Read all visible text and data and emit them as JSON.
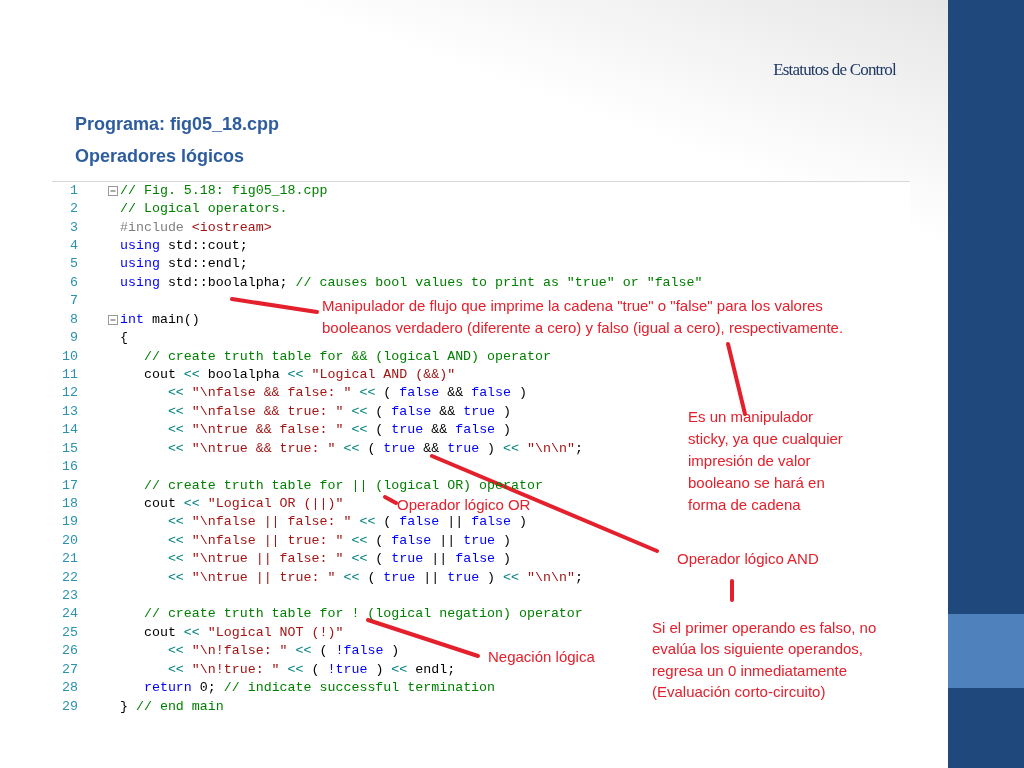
{
  "slide_title": "Estatutos de Control",
  "headings": [
    "Programa: fig05_18.cpp",
    "Operadores lógicos"
  ],
  "code": {
    "lines": [
      {
        "number": "1",
        "fold": true,
        "tokens": [
          {
            "kind": "comment",
            "text": "// Fig. 5.18: fig05_18.cpp"
          }
        ]
      },
      {
        "number": "2",
        "fold": false,
        "tokens": [
          {
            "kind": "comment",
            "text": "// Logical operators."
          }
        ]
      },
      {
        "number": "3",
        "fold": false,
        "tokens": [
          {
            "kind": "preprocessor",
            "text": "#include "
          },
          {
            "kind": "string",
            "text": "<iostream>"
          }
        ]
      },
      {
        "number": "4",
        "fold": false,
        "tokens": [
          {
            "kind": "keyword",
            "text": "using"
          },
          {
            "kind": "plain",
            "text": " std::cout;"
          }
        ]
      },
      {
        "number": "5",
        "fold": false,
        "tokens": [
          {
            "kind": "keyword",
            "text": "using"
          },
          {
            "kind": "plain",
            "text": " std::endl;"
          }
        ]
      },
      {
        "number": "6",
        "fold": false,
        "tokens": [
          {
            "kind": "keyword",
            "text": "using"
          },
          {
            "kind": "plain",
            "text": " std::boolalpha; "
          },
          {
            "kind": "comment",
            "text": "// causes bool values to print as \"true\" or \"false\""
          }
        ]
      },
      {
        "number": "7",
        "fold": false
      },
      {
        "number": "8",
        "fold": true,
        "tokens": [
          {
            "kind": "keyword",
            "text": "int"
          },
          {
            "kind": "plain",
            "text": " main()"
          }
        ]
      },
      {
        "number": "9",
        "fold": false,
        "tokens": [
          {
            "kind": "plain",
            "text": "{"
          }
        ]
      },
      {
        "number": "10",
        "fold": false,
        "tokens": [
          {
            "kind": "comment",
            "text": "   // create truth table for && (logical AND) operator"
          }
        ]
      },
      {
        "number": "11",
        "fold": false,
        "tokens": [
          {
            "kind": "plain",
            "text": "   cout "
          },
          {
            "kind": "operator",
            "text": "<<"
          },
          {
            "kind": "plain",
            "text": " boolalpha "
          },
          {
            "kind": "operator",
            "text": "<<"
          },
          {
            "kind": "string",
            "text": " \"Logical AND (&&)\""
          }
        ]
      },
      {
        "number": "12",
        "fold": false,
        "tokens": [
          {
            "kind": "operator",
            "text": "      <<"
          },
          {
            "kind": "string",
            "text": " \"\\nfalse && false: \" "
          },
          {
            "kind": "operator",
            "text": "<<"
          },
          {
            "kind": "plain",
            "text": " ( "
          },
          {
            "kind": "keyword",
            "text": "false"
          },
          {
            "kind": "plain",
            "text": " && "
          },
          {
            "kind": "keyword",
            "text": "false"
          },
          {
            "kind": "plain",
            "text": " )"
          }
        ]
      },
      {
        "number": "13",
        "fold": false,
        "tokens": [
          {
            "kind": "operator",
            "text": "      <<"
          },
          {
            "kind": "string",
            "text": " \"\\nfalse && true: \" "
          },
          {
            "kind": "operator",
            "text": "<<"
          },
          {
            "kind": "plain",
            "text": " ( "
          },
          {
            "kind": "keyword",
            "text": "false"
          },
          {
            "kind": "plain",
            "text": " && "
          },
          {
            "kind": "keyword",
            "text": "true"
          },
          {
            "kind": "plain",
            "text": " )"
          }
        ]
      },
      {
        "number": "14",
        "fold": false,
        "tokens": [
          {
            "kind": "operator",
            "text": "      <<"
          },
          {
            "kind": "string",
            "text": " \"\\ntrue && false: \" "
          },
          {
            "kind": "operator",
            "text": "<<"
          },
          {
            "kind": "plain",
            "text": " ( "
          },
          {
            "kind": "keyword",
            "text": "true"
          },
          {
            "kind": "plain",
            "text": " && "
          },
          {
            "kind": "keyword",
            "text": "false"
          },
          {
            "kind": "plain",
            "text": " )"
          }
        ]
      },
      {
        "number": "15",
        "fold": false,
        "tokens": [
          {
            "kind": "operator",
            "text": "      <<"
          },
          {
            "kind": "string",
            "text": " \"\\ntrue && true: \" "
          },
          {
            "kind": "operator",
            "text": "<<"
          },
          {
            "kind": "plain",
            "text": " ( "
          },
          {
            "kind": "keyword",
            "text": "true"
          },
          {
            "kind": "plain",
            "text": " && "
          },
          {
            "kind": "keyword",
            "text": "true"
          },
          {
            "kind": "plain",
            "text": " ) "
          },
          {
            "kind": "operator",
            "text": "<<"
          },
          {
            "kind": "string",
            "text": " \"\\n\\n\""
          },
          {
            "kind": "plain",
            "text": ";"
          }
        ]
      },
      {
        "number": "16",
        "fold": false
      },
      {
        "number": "17",
        "fold": false,
        "tokens": [
          {
            "kind": "comment",
            "text": "   // create truth table for || (logical OR) operator"
          }
        ]
      },
      {
        "number": "18",
        "fold": false,
        "tokens": [
          {
            "kind": "plain",
            "text": "   cout "
          },
          {
            "kind": "operator",
            "text": "<<"
          },
          {
            "kind": "string",
            "text": " \"Logical OR (||)\""
          }
        ]
      },
      {
        "number": "19",
        "fold": false,
        "tokens": [
          {
            "kind": "operator",
            "text": "      <<"
          },
          {
            "kind": "string",
            "text": " \"\\nfalse || false: \" "
          },
          {
            "kind": "operator",
            "text": "<<"
          },
          {
            "kind": "plain",
            "text": " ( "
          },
          {
            "kind": "keyword",
            "text": "false"
          },
          {
            "kind": "plain",
            "text": " || "
          },
          {
            "kind": "keyword",
            "text": "false"
          },
          {
            "kind": "plain",
            "text": " )"
          }
        ]
      },
      {
        "number": "20",
        "fold": false,
        "tokens": [
          {
            "kind": "operator",
            "text": "      <<"
          },
          {
            "kind": "string",
            "text": " \"\\nfalse || true: \" "
          },
          {
            "kind": "operator",
            "text": "<<"
          },
          {
            "kind": "plain",
            "text": " ( "
          },
          {
            "kind": "keyword",
            "text": "false"
          },
          {
            "kind": "plain",
            "text": " || "
          },
          {
            "kind": "keyword",
            "text": "true"
          },
          {
            "kind": "plain",
            "text": " )"
          }
        ]
      },
      {
        "number": "21",
        "fold": false,
        "tokens": [
          {
            "kind": "operator",
            "text": "      <<"
          },
          {
            "kind": "string",
            "text": " \"\\ntrue || false: \" "
          },
          {
            "kind": "operator",
            "text": "<<"
          },
          {
            "kind": "plain",
            "text": " ( "
          },
          {
            "kind": "keyword",
            "text": "true"
          },
          {
            "kind": "plain",
            "text": " || "
          },
          {
            "kind": "keyword",
            "text": "false"
          },
          {
            "kind": "plain",
            "text": " )"
          }
        ]
      },
      {
        "number": "22",
        "fold": false,
        "tokens": [
          {
            "kind": "operator",
            "text": "      <<"
          },
          {
            "kind": "string",
            "text": " \"\\ntrue || true: \" "
          },
          {
            "kind": "operator",
            "text": "<<"
          },
          {
            "kind": "plain",
            "text": " ( "
          },
          {
            "kind": "keyword",
            "text": "true"
          },
          {
            "kind": "plain",
            "text": " || "
          },
          {
            "kind": "keyword",
            "text": "true"
          },
          {
            "kind": "plain",
            "text": " ) "
          },
          {
            "kind": "operator",
            "text": "<<"
          },
          {
            "kind": "string",
            "text": " \"\\n\\n\""
          },
          {
            "kind": "plain",
            "text": ";"
          }
        ]
      },
      {
        "number": "23",
        "fold": false
      },
      {
        "number": "24",
        "fold": false,
        "tokens": [
          {
            "kind": "comment",
            "text": "   // create truth table for ! (logical negation) operator"
          }
        ]
      },
      {
        "number": "25",
        "fold": false,
        "tokens": [
          {
            "kind": "plain",
            "text": "   cout "
          },
          {
            "kind": "operator",
            "text": "<<"
          },
          {
            "kind": "string",
            "text": " \"Logical NOT (!)\""
          }
        ]
      },
      {
        "number": "26",
        "fold": false,
        "tokens": [
          {
            "kind": "operator",
            "text": "      <<"
          },
          {
            "kind": "string",
            "text": " \"\\n!false: \" "
          },
          {
            "kind": "operator",
            "text": "<<"
          },
          {
            "kind": "plain",
            "text": " ( "
          },
          {
            "kind": "keyword",
            "text": "!false"
          },
          {
            "kind": "plain",
            "text": " )"
          }
        ]
      },
      {
        "number": "27",
        "fold": false,
        "tokens": [
          {
            "kind": "operator",
            "text": "      <<"
          },
          {
            "kind": "string",
            "text": " \"\\n!true: \" "
          },
          {
            "kind": "operator",
            "text": "<<"
          },
          {
            "kind": "plain",
            "text": " ( "
          },
          {
            "kind": "keyword",
            "text": "!true"
          },
          {
            "kind": "plain",
            "text": " ) "
          },
          {
            "kind": "operator",
            "text": "<<"
          },
          {
            "kind": "plain",
            "text": " endl;"
          }
        ]
      },
      {
        "number": "28",
        "fold": false,
        "tokens": [
          {
            "kind": "keyword",
            "text": "   return"
          },
          {
            "kind": "plain",
            "text": " 0; "
          },
          {
            "kind": "comment",
            "text": "// indicate successful termination"
          }
        ]
      },
      {
        "number": "29",
        "fold": false,
        "tokens": [
          {
            "kind": "plain",
            "text": "} "
          },
          {
            "kind": "comment",
            "text": "// end main"
          }
        ]
      }
    ]
  },
  "annotations": [
    {
      "text": "Manipulador de flujo que imprime la cadena \"true\" o \"false\" para los valores\nbooleanos verdadero (diferente a cero) y falso (igual a cero), respectivamente."
    },
    {
      "text": "Operador lógico OR"
    },
    {
      "text": "Es un manipulador\nsticky, ya que cualquier\nimpresión de valor\nbooleano se hará en\nforma de cadena"
    },
    {
      "text": "Operador lógico AND"
    },
    {
      "text": "Negación lógica"
    },
    {
      "text": "Si el primer operando es falso, no\nevalúa los siguiente operandos,\nregresa un 0 inmediatamente\n(Evaluación corto-circuito)"
    }
  ]
}
